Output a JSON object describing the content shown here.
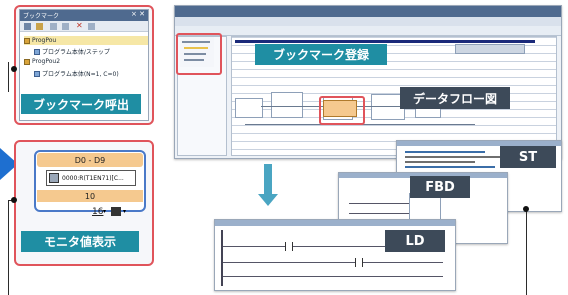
{
  "bookmark_panel": {
    "title": "ブックマーク",
    "close_glyph": "× ✕",
    "items": [
      {
        "label": "ProgPou",
        "icon": "folder-icon"
      },
      {
        "label": "プログラム本体/ステップ",
        "icon": "program-icon"
      },
      {
        "label": "ProgPou2",
        "icon": "folder-icon"
      },
      {
        "label": "プログラム本体(N=1, C=0)",
        "icon": "program-icon"
      }
    ],
    "callout": "ブックマーク呼出"
  },
  "monitor_panel": {
    "header": "D0 - D9",
    "value_text": "0000:R(T1EN71)[C...",
    "count": "10",
    "format": "16",
    "callout": "モニタ値表示"
  },
  "callouts": {
    "bookmark_register": "ブックマーク登録",
    "dataflow": "データフロー図",
    "st": "ST",
    "fbd": "FBD",
    "ld": "LD"
  },
  "colors": {
    "teal": "#1f8ea3",
    "dark_tag": "#3d4a59",
    "highlight_red": "#e0545b",
    "arrow_blue": "#1e6fd0",
    "panel_orange": "#f5c98f"
  }
}
